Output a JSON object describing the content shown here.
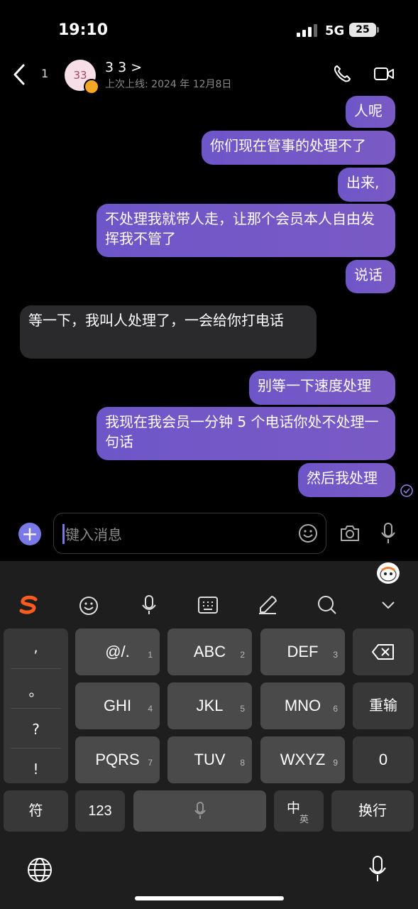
{
  "status_bar": {
    "time": "19:10",
    "network": "5G",
    "battery": "25"
  },
  "header": {
    "back_count": "1",
    "avatar_text": "33",
    "contact_name": "3 3 >",
    "last_seen": "上次上线: 2024 年 12月8日"
  },
  "messages": [
    {
      "direction": "out",
      "text": "人呢"
    },
    {
      "direction": "out",
      "text": "你们现在管事的处理不了"
    },
    {
      "direction": "out",
      "text": "出来,"
    },
    {
      "direction": "out",
      "text": "不处理我就带人走，让那个会员本人自由发挥我不管了"
    },
    {
      "direction": "out",
      "text": "说话"
    },
    {
      "direction": "in",
      "text": "等一下，我叫人处理了，一会给你打电话"
    },
    {
      "direction": "out",
      "text": "别等一下速度处理"
    },
    {
      "direction": "out",
      "text": "我现在我会员一分钟 5 个电话你处不处理一句话"
    },
    {
      "direction": "out",
      "text": "然后我处理"
    }
  ],
  "composer": {
    "placeholder": "键入消息"
  },
  "keyboard": {
    "punctuation": [
      ",",
      "。",
      "?",
      "!"
    ],
    "rows": [
      [
        {
          "label": "@/.",
          "hint": "1"
        },
        {
          "label": "ABC",
          "hint": "2"
        },
        {
          "label": "DEF",
          "hint": "3"
        }
      ],
      [
        {
          "label": "GHI",
          "hint": "4"
        },
        {
          "label": "JKL",
          "hint": "5"
        },
        {
          "label": "MNO",
          "hint": "6"
        }
      ],
      [
        {
          "label": "PQRS",
          "hint": "7"
        },
        {
          "label": "TUV",
          "hint": "8"
        },
        {
          "label": "WXYZ",
          "hint": "9"
        }
      ]
    ],
    "side_keys": {
      "retype": "重输",
      "zero": "0"
    },
    "bottom_row": {
      "symbols": "符",
      "numbers": "123",
      "lang_main": "中",
      "lang_sub": "英",
      "enter": "换行"
    }
  },
  "colors": {
    "outgoing_bubble": "#7059c6",
    "incoming_bubble": "#2a2a2c",
    "accent": "#7b78e8",
    "brand_logo": "#ff5a1f"
  }
}
